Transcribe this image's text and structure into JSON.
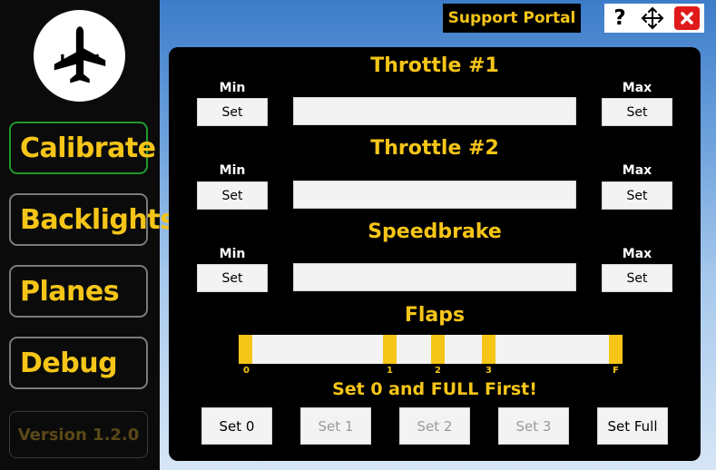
{
  "sidebar": {
    "logo_icon": "airplane-icon",
    "items": [
      {
        "label": "Calibrate",
        "active": true
      },
      {
        "label": "Backlights",
        "active": false
      },
      {
        "label": "Planes",
        "active": false
      },
      {
        "label": "Debug",
        "active": false
      }
    ],
    "version": "Version 1.2.0"
  },
  "header": {
    "support_portal": "Support Portal",
    "help": "?",
    "icons": [
      "help-icon",
      "move-icon",
      "close-icon"
    ]
  },
  "calibration": {
    "sections": [
      {
        "title": "Throttle #1",
        "min_label": "Min",
        "max_label": "Max",
        "min_button": "Set",
        "max_button": "Set"
      },
      {
        "title": "Throttle #2",
        "min_label": "Min",
        "max_label": "Max",
        "min_button": "Set",
        "max_button": "Set"
      },
      {
        "title": "Speedbrake",
        "min_label": "Min",
        "max_label": "Max",
        "min_button": "Set",
        "max_button": "Set"
      }
    ],
    "flaps": {
      "title": "Flaps",
      "ticks": [
        "0",
        "1",
        "2",
        "3",
        "F"
      ],
      "note": "Set 0 and FULL First!",
      "buttons": [
        {
          "label": "Set 0",
          "enabled": true
        },
        {
          "label": "Set 1",
          "enabled": false
        },
        {
          "label": "Set 2",
          "enabled": false
        },
        {
          "label": "Set 3",
          "enabled": false
        },
        {
          "label": "Set Full",
          "enabled": true
        }
      ]
    }
  },
  "colors": {
    "accent": "#f5c518",
    "active_border": "#1f9a2a",
    "close": "#e01a1a",
    "panel": "#000000"
  }
}
